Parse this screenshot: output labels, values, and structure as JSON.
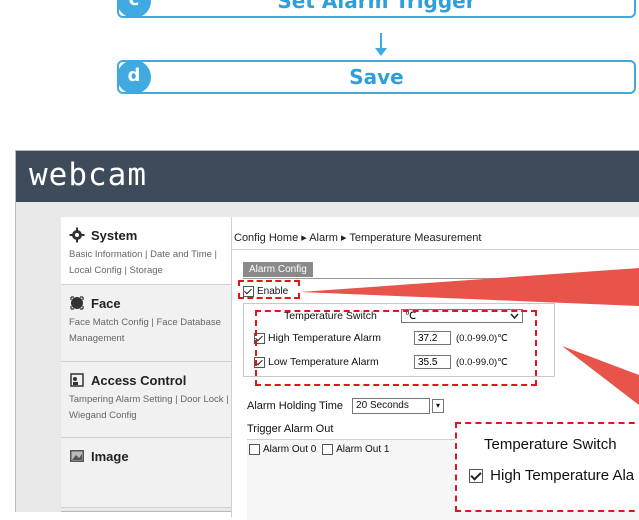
{
  "steps": [
    {
      "badge": "c",
      "label": "Set Alarm Trigger"
    },
    {
      "badge": "d",
      "label": "Save"
    }
  ],
  "app": {
    "logo": "webcam",
    "sidebar": [
      {
        "title": "System",
        "icon": "gear-icon",
        "sub": "Basic Information | Date and Time | Local Config | Storage"
      },
      {
        "title": "Face",
        "icon": "face-icon",
        "sub": "Face Match Config | Face Database Management"
      },
      {
        "title": "Access Control",
        "icon": "access-control-icon",
        "sub": "Tampering Alarm Setting | Door Lock | Wiegand Config"
      },
      {
        "title": "Image",
        "icon": "image-icon",
        "sub": ""
      }
    ],
    "breadcrumb": "Config Home ▸ Alarm ▸ Temperature Measurement",
    "tab": "Alarm Config",
    "enable_label": "Enable",
    "temp_switch_label": "Temperature Switch",
    "temp_switch_value": "℃",
    "high_alarm_label": "High Temperature Alarm",
    "high_alarm_value": "37.2",
    "high_alarm_range": "(0.0-99.0)℃",
    "low_alarm_label": "Low Temperature Alarm",
    "low_alarm_value": "35.5",
    "low_alarm_range": "(0.0-99.0)℃",
    "hold_label": "Alarm Holding Time",
    "hold_value": "20 Seconds",
    "trigger_label": "Trigger Alarm Out",
    "trigger_options": [
      "Alarm Out 0",
      "Alarm Out 1"
    ]
  },
  "zoom": {
    "title": "Temperature Switch",
    "row": "High Temperature Ala"
  },
  "colors": {
    "accent": "#3fa9e0",
    "annotation": "#e0161b",
    "header": "#3d4b5a"
  }
}
